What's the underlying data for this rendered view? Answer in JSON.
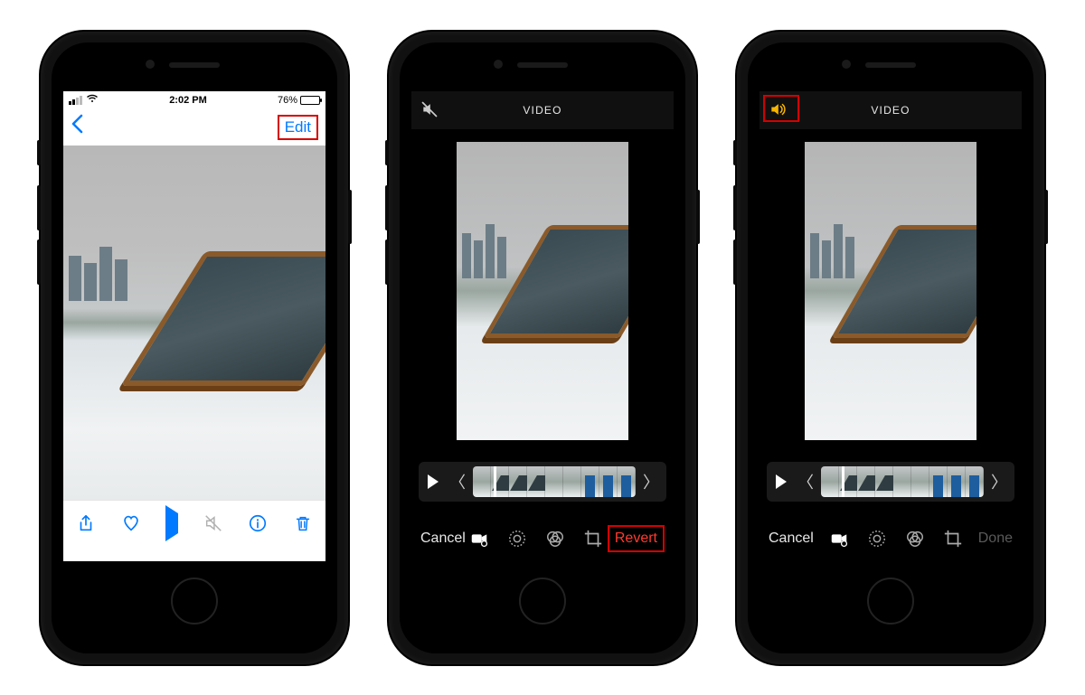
{
  "phone1": {
    "status": {
      "time": "2:02 PM",
      "battery_pct": "76%"
    },
    "nav": {
      "edit_label": "Edit"
    },
    "toolbar": {
      "share_icon": "share",
      "favorite_icon": "heart",
      "play_icon": "play",
      "mute_icon": "mute",
      "info_icon": "info",
      "trash_icon": "trash"
    }
  },
  "phone2": {
    "header": {
      "title": "VIDEO",
      "sound_icon": "speaker-off"
    },
    "toolbar": {
      "cancel_label": "Cancel",
      "action_label": "Revert",
      "action_color": "#ff3b30",
      "video_icon": "video",
      "adjust_icon": "adjust",
      "filters_icon": "filters",
      "crop_icon": "crop"
    }
  },
  "phone3": {
    "header": {
      "title": "VIDEO",
      "sound_icon": "speaker-on"
    },
    "toolbar": {
      "cancel_label": "Cancel",
      "action_label": "Done",
      "action_dim": true,
      "video_icon": "video",
      "adjust_icon": "adjust",
      "filters_icon": "filters",
      "crop_icon": "crop"
    }
  }
}
